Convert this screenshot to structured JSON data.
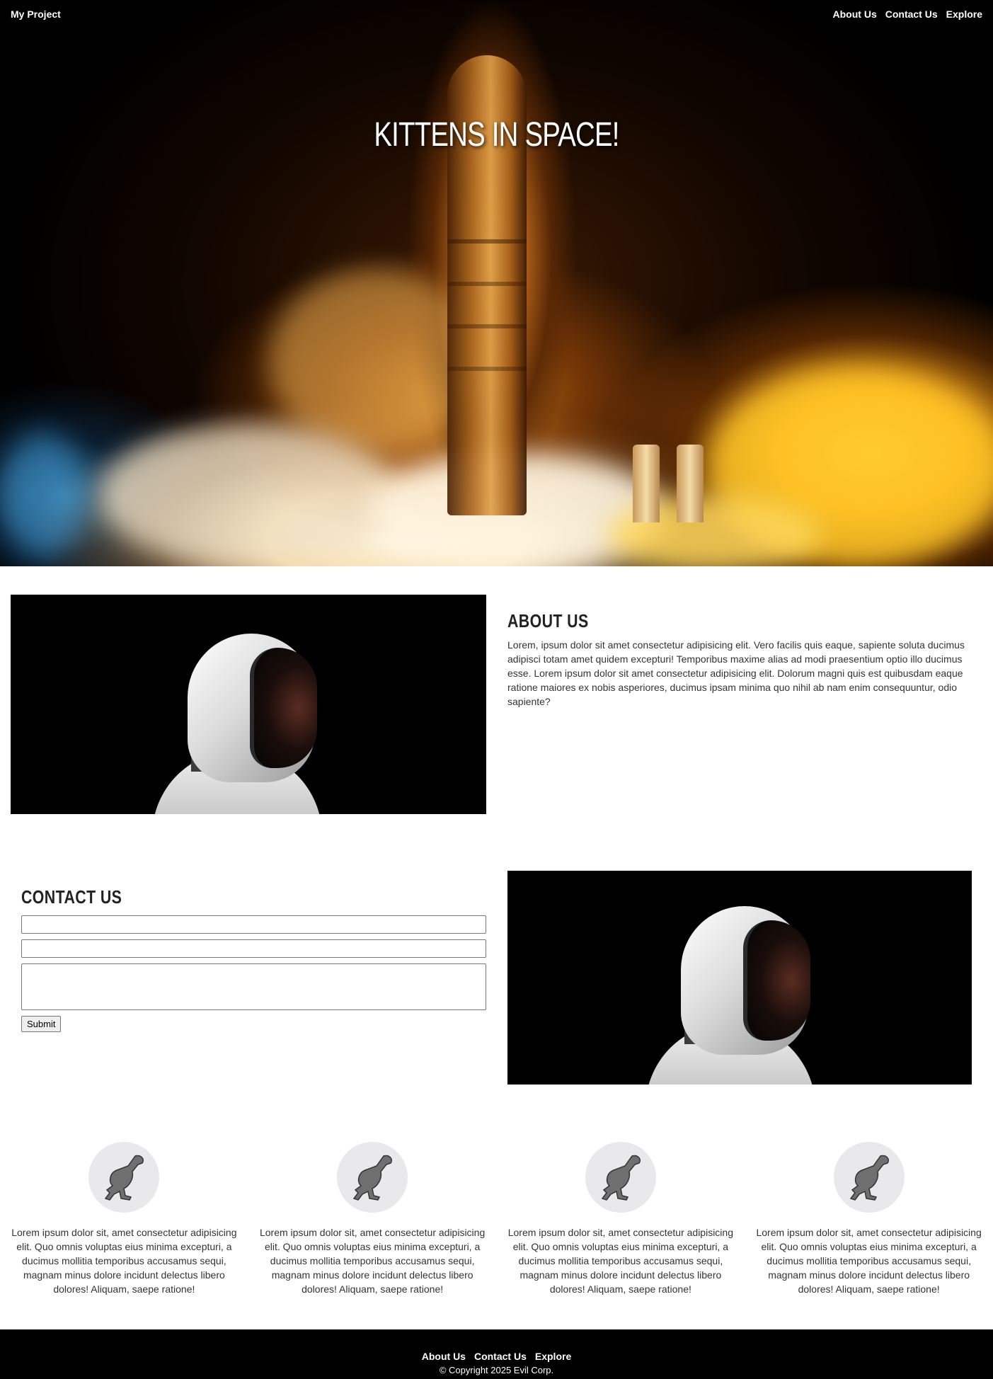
{
  "nav": {
    "brand": "My Project",
    "links": [
      "About Us",
      "Contact Us",
      "Explore"
    ]
  },
  "hero": {
    "title": "KITTENS IN SPACE!",
    "image": "rocket-launch-image"
  },
  "about": {
    "title": "ABOUT US",
    "body": "Lorem, ipsum dolor sit amet consectetur adipisicing elit. Vero facilis quis eaque, sapiente soluta ducimus adipisci totam amet quidem excepturi! Temporibus maxime alias ad modi praesentium optio illo ducimus esse. Lorem ipsum dolor sit amet consectetur adipisicing elit. Dolorum magni quis est quibusdam eaque ratione maiores ex nobis asperiores, ducimus ipsam minima quo nihil ab nam enim consequuntur, odio sapiente?",
    "image": "astronaut-image"
  },
  "contact": {
    "title": "CONTACT US",
    "field1_value": "",
    "field2_value": "",
    "message_value": "",
    "submit_label": "Submit",
    "image": "astronaut-image"
  },
  "features": [
    {
      "icon": "creature-icon",
      "text": "Lorem ipsum dolor sit, amet consectetur adipisicing elit. Quo omnis voluptas eius minima excepturi, a ducimus mollitia temporibus accusamus sequi, magnam minus dolore incidunt delectus libero dolores! Aliquam, saepe ratione!"
    },
    {
      "icon": "creature-icon",
      "text": "Lorem ipsum dolor sit, amet consectetur adipisicing elit. Quo omnis voluptas eius minima excepturi, a ducimus mollitia temporibus accusamus sequi, magnam minus dolore incidunt delectus libero dolores! Aliquam, saepe ratione!"
    },
    {
      "icon": "creature-icon",
      "text": "Lorem ipsum dolor sit, amet consectetur adipisicing elit. Quo omnis voluptas eius minima excepturi, a ducimus mollitia temporibus accusamus sequi, magnam minus dolore incidunt delectus libero dolores! Aliquam, saepe ratione!"
    },
    {
      "icon": "creature-icon",
      "text": "Lorem ipsum dolor sit, amet consectetur adipisicing elit. Quo omnis voluptas eius minima excepturi, a ducimus mollitia temporibus accusamus sequi, magnam minus dolore incidunt delectus libero dolores! Aliquam, saepe ratione!"
    }
  ],
  "footer": {
    "links": [
      "About Us",
      "Contact Us",
      "Explore"
    ],
    "copyright": "© Copyright 2025 Evil Corp."
  },
  "colors": {
    "footer_bg": "#000000",
    "nav_text": "#ffffff",
    "icon_circle": "#e9e9ec"
  }
}
